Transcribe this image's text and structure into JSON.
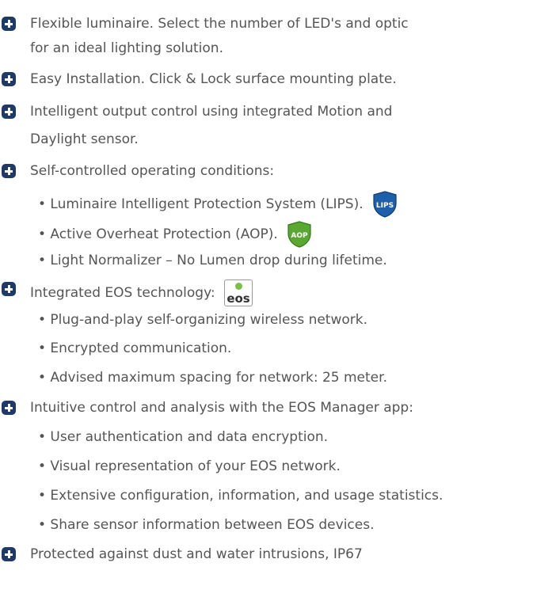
{
  "features": [
    {
      "lines": [
        "Flexible luminaire. Select the number of LED's and optic",
        "for an ideal lighting solution."
      ]
    },
    {
      "lines": [
        "Easy Installation. Click & Lock surface mounting plate."
      ]
    },
    {
      "lines": [
        "Intelligent output control using integrated Motion and",
        "Daylight sensor."
      ]
    },
    {
      "lines": [
        "Self-controlled operating conditions:"
      ],
      "subs": [
        "• Luminaire Intelligent Protection System (LIPS).",
        "• Active Overheat Protection (AOP).",
        "• Light Normalizer – No Lumen drop during lifetime."
      ]
    },
    {
      "lines": [
        "Integrated EOS technology:"
      ],
      "subs": [
        "• Plug-and-play self-organizing wireless network.",
        "• Encrypted communication.",
        "• Advised maximum spacing for network: 25 meter."
      ]
    },
    {
      "lines": [
        "Intuitive control and analysis with the EOS Manager app:"
      ],
      "subs": [
        "• User authentication and data encryption.",
        "• Visual representation of your EOS network.",
        "• Extensive configuration, information, and usage statistics.",
        "• Share sensor information between EOS devices."
      ]
    },
    {
      "lines": [
        "Protected against dust and water intrusions, IP67"
      ]
    }
  ],
  "badges": {
    "lips": {
      "label": "LIPS",
      "color": "#1d5fa8"
    },
    "aop": {
      "label": "AOP",
      "color": "#5aa832"
    },
    "eos": {
      "label": "eos",
      "dot_color": "#7cc043"
    }
  },
  "colors": {
    "bullet": "#1f3a68",
    "text": "#555555"
  }
}
